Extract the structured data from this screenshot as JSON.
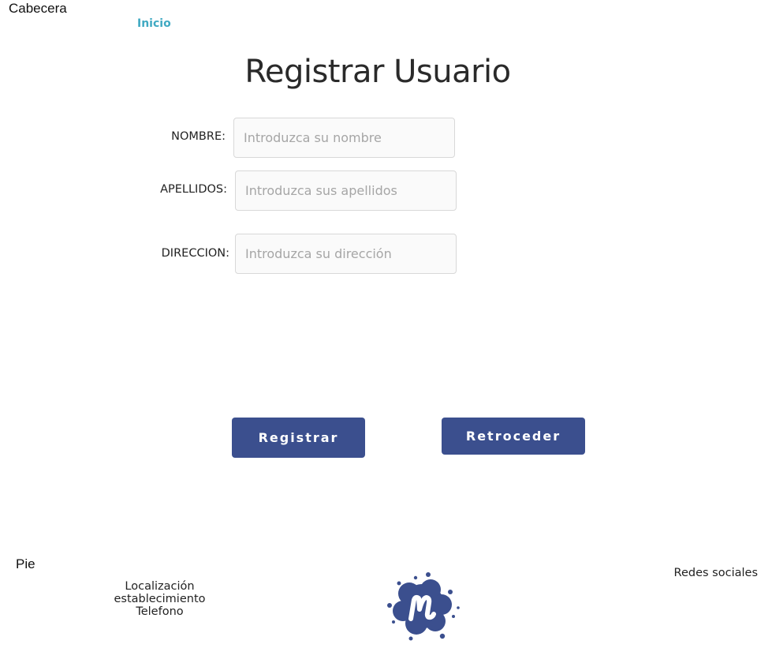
{
  "header": {
    "label": "Cabecera",
    "nav_link": "Inicio"
  },
  "page_title": "Registrar Usuario",
  "form": {
    "fields": [
      {
        "label": "NOMBRE:",
        "placeholder": "Introduzca su nombre",
        "value": ""
      },
      {
        "label": "APELLIDOS:",
        "placeholder": "Introduzca sus apellidos",
        "value": ""
      },
      {
        "label": "DIRECCION:",
        "placeholder": "Introduzca su dirección",
        "value": ""
      }
    ],
    "submit_label": "Registrar",
    "back_label": "Retroceder"
  },
  "footer": {
    "label": "Pie",
    "location_line1": "Localización establecimiento",
    "location_line2": "Telefono",
    "social": "Redes sociales",
    "logo_icon": "meetup-logo-icon"
  },
  "colors": {
    "accent": "#3b4f8e",
    "link": "#3fa9c2",
    "input_background": "#fafafa",
    "input_border": "#d8d8d8"
  }
}
